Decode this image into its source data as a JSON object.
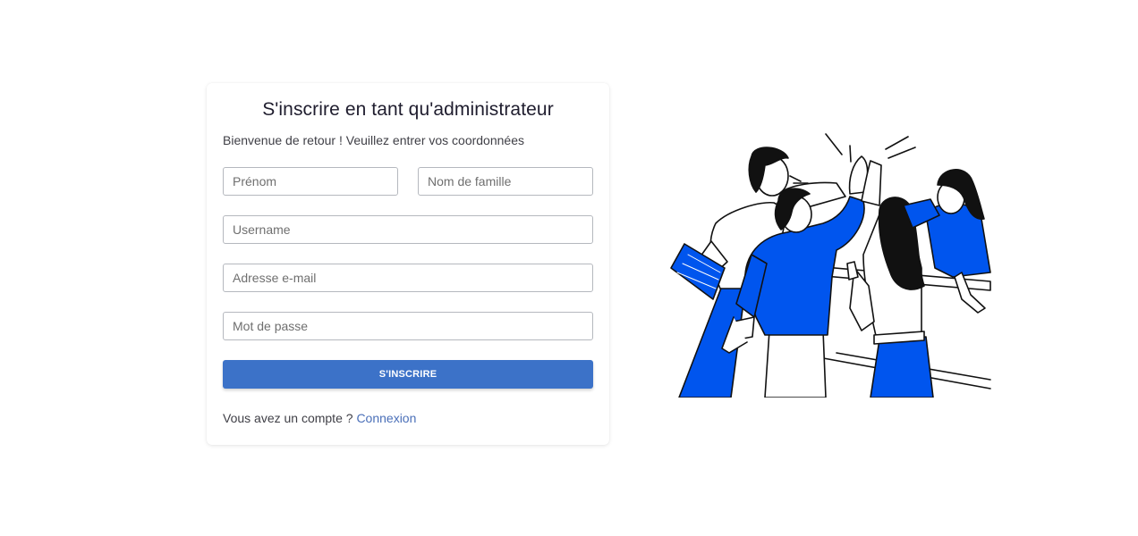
{
  "form": {
    "title": "S'inscrire en tant qu'administrateur",
    "subtitle": "Bienvenue de retour ! Veuillez entrer vos coordonnées",
    "fields": {
      "first_name_placeholder": "Prénom",
      "last_name_placeholder": "Nom de famille",
      "username_placeholder": "Username",
      "email_placeholder": "Adresse e-mail",
      "password_placeholder": "Mot de passe"
    },
    "submit_label": "S'INSCRIRE",
    "footer_text": "Vous avez un compte ? ",
    "login_link": "Connexion"
  },
  "illustration": {
    "icon": "team-high-five-illustration",
    "accent_color": "#0055ee",
    "line_color": "#111111"
  },
  "colors": {
    "primary_button": "#3c72c8",
    "link": "#4a6fb8",
    "title": "#1f1d2e"
  }
}
